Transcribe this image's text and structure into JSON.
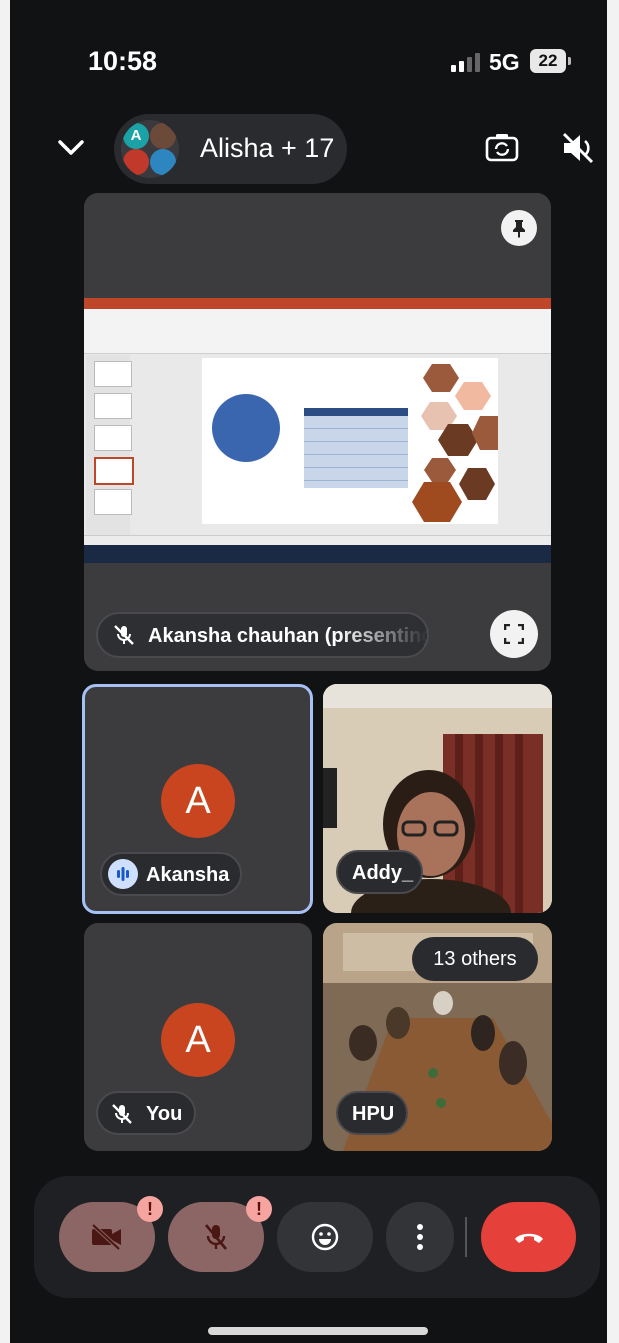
{
  "status_bar": {
    "time": "10:58",
    "network": "5G",
    "battery": "22"
  },
  "header": {
    "title": "Alisha + 17",
    "avatar_letter": "A"
  },
  "presentation": {
    "presenter_label": "Akansha chauhan (presenting)"
  },
  "tiles": [
    {
      "name": "Akansha",
      "avatar_letter": "A",
      "speaking": true
    },
    {
      "name": "Addy_"
    },
    {
      "name": "You",
      "avatar_letter": "A",
      "muted": true
    },
    {
      "name": "HPU",
      "others_label": "13 others"
    }
  ],
  "controls": {
    "warning_mark": "!"
  },
  "colors": {
    "background": "#111214",
    "tile": "#3c3c3e",
    "avatar": "#c8451f",
    "end_call": "#e5403a",
    "active_border": "#a8c1f5"
  }
}
